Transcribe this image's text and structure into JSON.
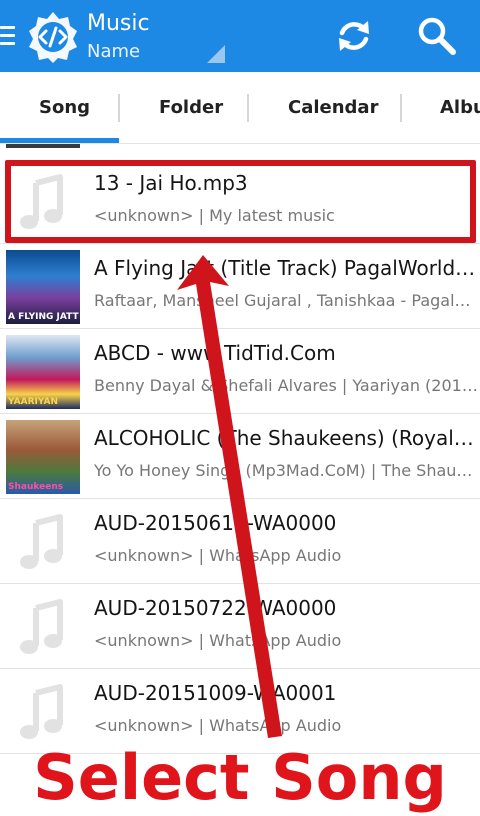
{
  "app": {
    "title": "Music",
    "sort_label": "Name",
    "brand_color": "#1e88e5",
    "icons": [
      "menu-icon",
      "code-logo-icon",
      "refresh-icon",
      "search-icon"
    ]
  },
  "tabs": [
    {
      "label": "Song",
      "selected": true
    },
    {
      "label": "Folder",
      "selected": false
    },
    {
      "label": "Calendar",
      "selected": false
    },
    {
      "label": "Albu",
      "selected": false
    }
  ],
  "songs": [
    {
      "title": "13 - Jai Ho.mp3",
      "subtitle": "<unknown> | My latest music",
      "art": "music-note-icon"
    },
    {
      "title": "A Flying Jatt (Title Track) PagalWorld.c...",
      "subtitle": "Raftaar, Mansheel Gujaral , Tanishkaa - PagalWorl...",
      "art": "album-art",
      "art_text": "A FLYING JATT"
    },
    {
      "title": "ABCD - www.TidTid.Com",
      "subtitle": "Benny Dayal & Shefali Alvares | Yaariyan (2013)",
      "art": "album-art",
      "art_text": "YAARIYAN"
    },
    {
      "title": "ALCOHOLIC (The Shaukeens) (RoyalJa...",
      "subtitle": "Yo Yo Honey Singh (Mp3Mad.CoM) | The Shauke...",
      "art": "album-art",
      "art_text": "Shaukeens"
    },
    {
      "title": "AUD-20150619-WA0000",
      "subtitle": "<unknown> | WhatsApp Audio",
      "art": "music-note-icon"
    },
    {
      "title": "AUD-20150722-WA0000",
      "subtitle": "<unknown> | WhatsApp Audio",
      "art": "music-note-icon"
    },
    {
      "title": "AUD-20151009-WA0001",
      "subtitle": "<unknown> | WhatsApp Audio",
      "art": "music-note-icon"
    }
  ],
  "annotation": {
    "caption": "Select Song",
    "color": "#d0141b"
  }
}
